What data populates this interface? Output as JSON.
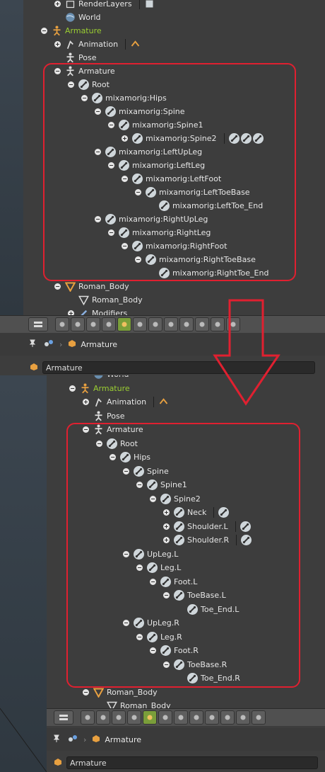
{
  "top": {
    "rows": [
      {
        "label": "RenderLayers",
        "icon": "render-layers-icon",
        "extra": 1
      },
      {
        "label": "World",
        "icon": "world-icon"
      },
      {
        "label": "Armature",
        "icon": "armature-object-icon",
        "active": true
      },
      {
        "label": "Animation",
        "icon": "animation-icon",
        "extra": 1
      },
      {
        "label": "Pose",
        "icon": "pose-icon"
      },
      {
        "label": "Armature",
        "icon": "armature-data-icon"
      },
      {
        "label": "Root",
        "icon": "bone-icon"
      },
      {
        "label": "mixamorig:Hips",
        "icon": "bone-icon"
      },
      {
        "label": "mixamorig:Spine",
        "icon": "bone-icon"
      },
      {
        "label": "mixamorig:Spine1",
        "icon": "bone-icon"
      },
      {
        "label": "mixamorig:Spine2",
        "icon": "bone-icon",
        "extra": 3
      },
      {
        "label": "mixamorig:LeftUpLeg",
        "icon": "bone-icon"
      },
      {
        "label": "mixamorig:LeftLeg",
        "icon": "bone-icon"
      },
      {
        "label": "mixamorig:LeftFoot",
        "icon": "bone-icon"
      },
      {
        "label": "mixamorig:LeftToeBase",
        "icon": "bone-icon"
      },
      {
        "label": "mixamorig:LeftToe_End",
        "icon": "bone-icon"
      },
      {
        "label": "mixamorig:RightUpLeg",
        "icon": "bone-icon"
      },
      {
        "label": "mixamorig:RightLeg",
        "icon": "bone-icon"
      },
      {
        "label": "mixamorig:RightFoot",
        "icon": "bone-icon"
      },
      {
        "label": "mixamorig:RightToeBase",
        "icon": "bone-icon"
      },
      {
        "label": "mixamorig:RightToe_End",
        "icon": "bone-icon"
      },
      {
        "label": "Roman_Body",
        "icon": "mesh-object-icon"
      },
      {
        "label": "Roman_Body",
        "icon": "mesh-data-icon"
      },
      {
        "label": "Modifiers",
        "icon": "modifier-icon"
      }
    ],
    "breadcrumb": "Armature",
    "datablock": "Armature"
  },
  "bottom": {
    "rows": [
      {
        "label": "World",
        "icon": "world-icon"
      },
      {
        "label": "Armature",
        "icon": "armature-object-icon",
        "active": true
      },
      {
        "label": "Animation",
        "icon": "animation-icon",
        "extra": 1
      },
      {
        "label": "Pose",
        "icon": "pose-icon"
      },
      {
        "label": "Armature",
        "icon": "armature-data-icon"
      },
      {
        "label": "Root",
        "icon": "bone-icon"
      },
      {
        "label": "Hips",
        "icon": "bone-icon"
      },
      {
        "label": "Spine",
        "icon": "bone-icon"
      },
      {
        "label": "Spine1",
        "icon": "bone-icon"
      },
      {
        "label": "Spine2",
        "icon": "bone-icon"
      },
      {
        "label": "Neck",
        "icon": "bone-icon",
        "extra": 1
      },
      {
        "label": "Shoulder.L",
        "icon": "bone-icon",
        "extra": 1
      },
      {
        "label": "Shoulder.R",
        "icon": "bone-icon",
        "extra": 1
      },
      {
        "label": "UpLeg.L",
        "icon": "bone-icon"
      },
      {
        "label": "Leg.L",
        "icon": "bone-icon"
      },
      {
        "label": "Foot.L",
        "icon": "bone-icon"
      },
      {
        "label": "ToeBase.L",
        "icon": "bone-icon"
      },
      {
        "label": "Toe_End.L",
        "icon": "bone-icon"
      },
      {
        "label": "UpLeg.R",
        "icon": "bone-icon"
      },
      {
        "label": "Leg.R",
        "icon": "bone-icon"
      },
      {
        "label": "Foot.R",
        "icon": "bone-icon"
      },
      {
        "label": "ToeBase.R",
        "icon": "bone-icon"
      },
      {
        "label": "Toe_End.R",
        "icon": "bone-icon"
      },
      {
        "label": "Roman_Body",
        "icon": "mesh-object-icon"
      },
      {
        "label": "Roman_Body",
        "icon": "mesh-data-icon"
      }
    ],
    "breadcrumb": "Armature",
    "datablock": "Armature"
  },
  "colors": {
    "highlight": "#e02030",
    "active_text": "#9acd32",
    "active_tab": "#7a9e3a"
  }
}
